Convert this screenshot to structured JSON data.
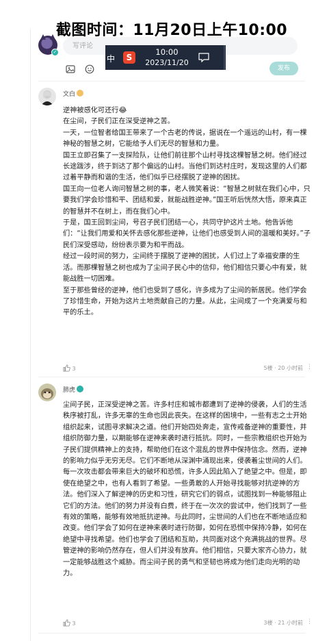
{
  "stamp": "截图时间：11月20日上午10:00",
  "composer": {
    "placeholder": "写评论",
    "publish_label": "发布",
    "icons": [
      "image-icon",
      "emoji-icon"
    ]
  },
  "taskbar": {
    "ime": "中",
    "sogou": "S",
    "time": "10:00",
    "date": "2023/11/20"
  },
  "comments": [
    {
      "author": "文白",
      "paragraphs": [
        "逆神被感化可还行😂",
        "在尘间，子民们正在深受逆神之苦。",
        "一天，一位智者给国王带来了一个古老的传说，据说在一个遥远的山村，有一棵神秘的智慧之树，它能给予人们无尽的智慧和力量。",
        "国王立即召集了一支探险队，让他们前往那个山村寻找这棵智慧之树。他们经过长途跋涉，终于到达了那个偏远的山村。当他们到达村庄时，发现这里的人们都过着平静而和谐的生活，他们似乎已经摆脱了逆神的困扰。",
        "国王向一位老人询问智慧之树的事，老人微笑着说：“智慧之树就在我们心中，只要我们学会珍惜和平、团结和爱，就能战胜逆神。”国王听后恍然大悟，原来真正的智慧并不在树上，而在我们心中。",
        "于是，国王回到尘间，号召子民们团结一心，共同守护这片土地。他告诉他们：“让我们用爱和关怀去感化那些逆神，让他们也感受到人间的温暖和美好。”子民们深受感动，纷纷表示要为和平而战。",
        "经过一段时间的努力，尘间终于摆脱了逆神的困扰，人们过上了幸福安康的生活。而那棵智慧之树也成为了尘间子民心中的信仰，他们相信只要心中有爱，就能战胜一切困难。",
        "至于那些曾经的逆神，他们也受到了感化，许多成为了尘间的新居民。他们学会了珍惜生命，开始为这片土地贡献自己的力量。从此，尘间成了一个充满爱与和平的乐土。"
      ],
      "likes": "3",
      "floor": "5楼 · 20 小时前",
      "reply_label": "",
      "more": "⋮"
    },
    {
      "author": "肺虎",
      "paragraphs": [
        "尘间子民，正深受逆神之苦。许多村庄和城市都遭到了逆神的侵袭，人们的生活秩序被打乱，许多无辜的生命也因此丧失。在这样的困境中，一些有志之士开始组织起来，试图寻求解决之道。他们开始四处奔走，宣传戒备逆神的重要性，并组织防御力量，以期能够在逆神来袭时进行抵抗。同时，一些宗教组织也开始为子民们提供精神上的支持，帮助他们在这个混乱的世界中保持信念。然而，逆神的影响力似乎无穷无尽。它们不断地从深渊中涌现出来，侵袭着尘世间的人们。每一次攻击都会带来巨大的破坏和恐慌，许多人因此陷入了绝望之中。但是，即使在绝望之中，也有人看到了希望。一些勇敢的人开始寻找能够对抗逆神的方法。他们深入了解逆神的历史和习性，研究它们的弱点，试图找到一种能够阻止它们的方法。他们的努力并没有白费，终于在一次次的尝试中，他们找到了一些有效的策略，能够有效地抵抗逆神。与此同时，尘世间的人们也在不断地适应和改变。他们学会了如何在逆神来袭时进行防御，如何在恐慌中保持冷静，如何在绝望中寻找希望。他们也学会了团结和互助，共同面对这个充满挑战的世界。尽管逆神的影响仍然存在，但人们并没有放弃。他们相信，只要大家齐心协力，就一定能够战胜这个威胁。而尘间子民的勇气和坚韧也将成为他们走向光明的动力。"
      ],
      "likes": "3",
      "floor": "3楼 · 21 小时前",
      "reply_label": "",
      "more": "⋮"
    }
  ],
  "colors": {
    "accent": "#2db3aa",
    "publish_bg": "#a9dcd8",
    "taskbar_bg": "#202a3a"
  }
}
